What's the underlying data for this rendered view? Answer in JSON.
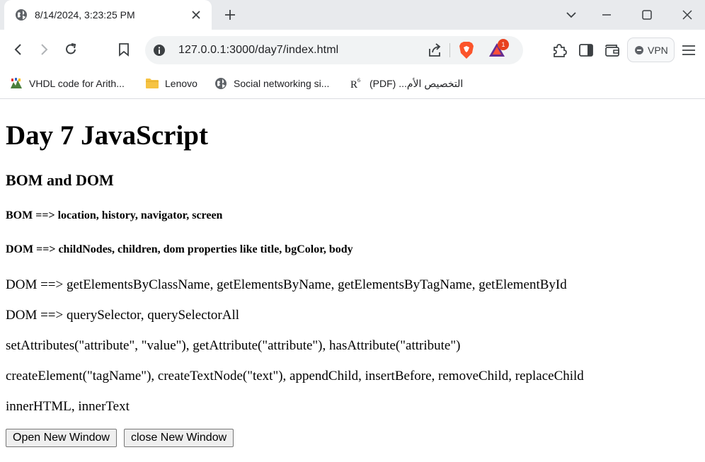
{
  "browser": {
    "tab_title": "8/14/2024, 3:23:25 PM",
    "url": "127.0.0.1:3000/day7/index.html",
    "rewards_badge": "1",
    "vpn_label": "VPN",
    "bookmarks": [
      {
        "label": "VHDL code for Arith...",
        "icon": "vhdl-favicon"
      },
      {
        "label": "Lenovo",
        "icon": "folder-icon"
      },
      {
        "label": "Social networking si...",
        "icon": "globe-icon"
      },
      {
        "label": "(PDF) ...التخصيص الأم",
        "icon": "researchgate-icon"
      }
    ]
  },
  "page": {
    "heading": "Day 7 JavaScript",
    "subheading": "BOM and DOM",
    "bom_line": "BOM ==> location, history, navigator, screen",
    "dom_line": "DOM ==> childNodes, children, dom properties like title, bgColor, body",
    "paragraphs": [
      "DOM ==> getElementsByClassName, getElementsByName, getElementsByTagName, getElementById",
      "DOM ==> querySelector, querySelectorAll",
      "setAttributes(\"attribute\", \"value\"), getAttribute(\"attribute\"), hasAttribute(\"attribute\")",
      "createElement(\"tagName\"), createTextNode(\"text\"), appendChild, insertBefore, removeChild, replaceChild",
      "innerHTML, innerText"
    ],
    "open_button": "Open New Window",
    "close_button": "close New Window"
  },
  "colors": {
    "tabstrip_bg": "#e8eaed",
    "omnibox_bg": "#f1f3f4",
    "brave_orange": "#fb542b",
    "badge_red": "#e8421f"
  }
}
